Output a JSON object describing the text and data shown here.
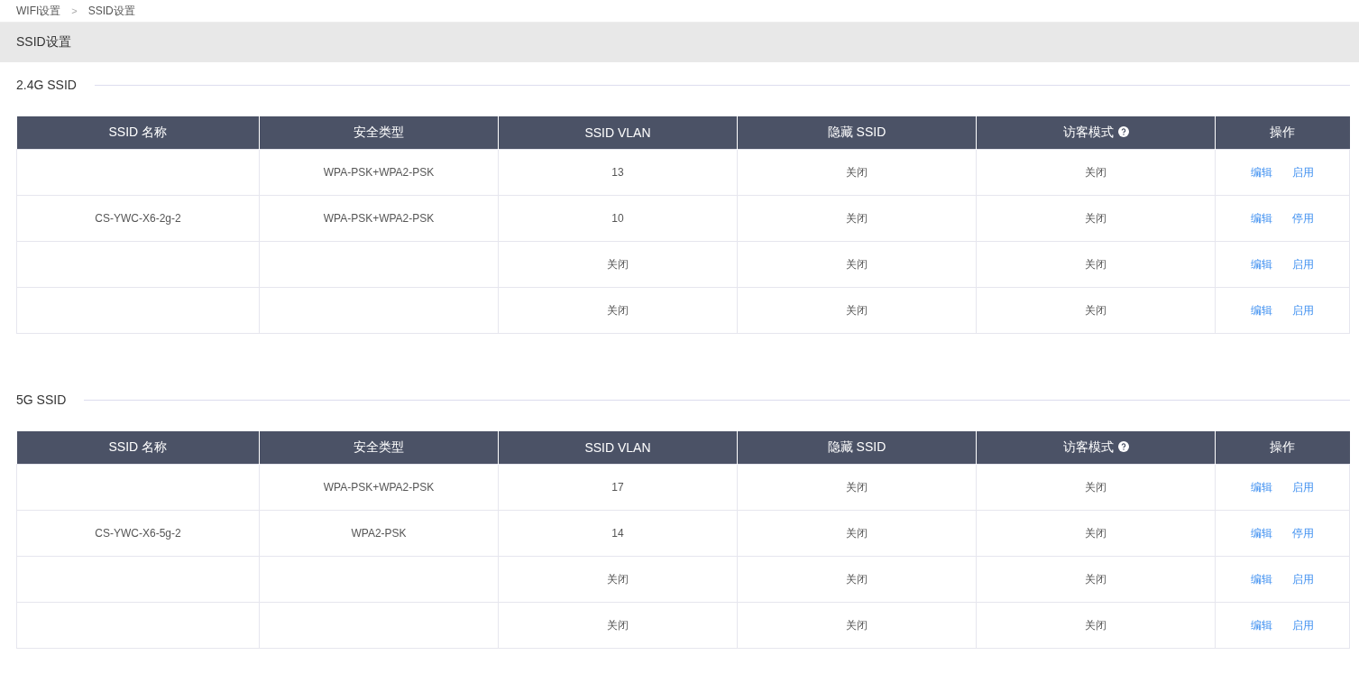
{
  "breadcrumb": [
    {
      "label": "WIFI设置"
    },
    {
      "label": "SSID设置"
    }
  ],
  "breadcrumb_separator": ">",
  "page_header": {
    "title": "SSID设置"
  },
  "sections": [
    {
      "title": "2.4G SSID",
      "table": {
        "columns": [
          {
            "label": "SSID 名称",
            "help": false
          },
          {
            "label": "安全类型",
            "help": false
          },
          {
            "label": "SSID VLAN",
            "help": false
          },
          {
            "label": "隐藏 SSID",
            "help": false
          },
          {
            "label": "访客模式",
            "help": true
          },
          {
            "label": "操作",
            "help": false
          }
        ],
        "rows": [
          {
            "name": "",
            "security": "WPA-PSK+WPA2-PSK",
            "vlan": "13",
            "hidden": "关闭",
            "guest": "关闭",
            "actions": [
              "编辑",
              "启用"
            ]
          },
          {
            "name": "CS-YWC-X6-2g-2",
            "security": "WPA-PSK+WPA2-PSK",
            "vlan": "10",
            "hidden": "关闭",
            "guest": "关闭",
            "actions": [
              "编辑",
              "停用"
            ]
          },
          {
            "name": "",
            "security": "",
            "vlan": "关闭",
            "hidden": "关闭",
            "guest": "关闭",
            "actions": [
              "编辑",
              "启用"
            ]
          },
          {
            "name": "",
            "security": "",
            "vlan": "关闭",
            "hidden": "关闭",
            "guest": "关闭",
            "actions": [
              "编辑",
              "启用"
            ]
          }
        ]
      }
    },
    {
      "title": "5G SSID",
      "table": {
        "columns": [
          {
            "label": "SSID 名称",
            "help": false
          },
          {
            "label": "安全类型",
            "help": false
          },
          {
            "label": "SSID VLAN",
            "help": false
          },
          {
            "label": "隐藏 SSID",
            "help": false
          },
          {
            "label": "访客模式",
            "help": true
          },
          {
            "label": "操作",
            "help": false
          }
        ],
        "rows": [
          {
            "name": "",
            "security": "WPA-PSK+WPA2-PSK",
            "vlan": "17",
            "hidden": "关闭",
            "guest": "关闭",
            "actions": [
              "编辑",
              "启用"
            ]
          },
          {
            "name": "CS-YWC-X6-5g-2",
            "security": "WPA2-PSK",
            "vlan": "14",
            "hidden": "关闭",
            "guest": "关闭",
            "actions": [
              "编辑",
              "停用"
            ]
          },
          {
            "name": "",
            "security": "",
            "vlan": "关闭",
            "hidden": "关闭",
            "guest": "关闭",
            "actions": [
              "编辑",
              "启用"
            ]
          },
          {
            "name": "",
            "security": "",
            "vlan": "关闭",
            "hidden": "关闭",
            "guest": "关闭",
            "actions": [
              "编辑",
              "启用"
            ]
          }
        ]
      }
    }
  ]
}
